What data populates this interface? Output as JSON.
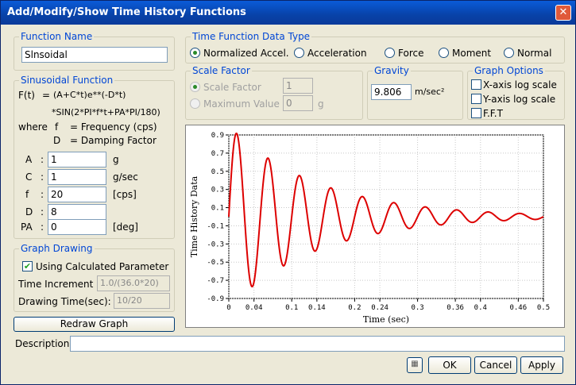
{
  "window": {
    "title": "Add/Modify/Show Time History Functions",
    "close_glyph": "✕"
  },
  "function_name": {
    "label": "Function Name",
    "value": "Slnsoidal"
  },
  "sinusoidal": {
    "title": "Sinusoidal Function",
    "formula_lhs": "F(t)",
    "eq": "=",
    "formula_line1": "(A+C*t)e**(-D*t)",
    "formula_line2": "*SIN(2*PI*f*t+PA*PI/180)",
    "where": "where",
    "f_name": "f",
    "f_def": "= Frequency (cps)",
    "d_name": "D",
    "d_def": "= Damping Factor",
    "params": [
      {
        "name": "A",
        "sep": ":",
        "value": "1",
        "unit": "g"
      },
      {
        "name": "C",
        "sep": ":",
        "value": "1",
        "unit": "g/sec"
      },
      {
        "name": "f",
        "sep": ":",
        "value": "20",
        "unit": "[cps]"
      },
      {
        "name": "D",
        "sep": ":",
        "value": "8",
        "unit": ""
      },
      {
        "name": "PA",
        "sep": ":",
        "value": "0",
        "unit": "[deg]"
      }
    ]
  },
  "graph_drawing": {
    "title": "Graph Drawing",
    "use_calc_label": "Using Calculated Parameter",
    "use_calc_checked": true,
    "time_inc_label": "Time Increment :",
    "time_inc_value": "1.0/(36.0*20)",
    "draw_time_label": "Drawing Time(sec):",
    "draw_time_value": "10/20"
  },
  "redraw_label": "Redraw Graph",
  "data_type": {
    "title": "Time Function Data Type",
    "options": [
      "Normalized Accel.",
      "Acceleration",
      "Force",
      "Moment",
      "Normal"
    ],
    "selected": "Normalized Accel."
  },
  "scale_factor": {
    "title": "Scale Factor",
    "sf_label": "Scale Factor",
    "sf_value": "1",
    "max_label": "Maximum Value",
    "max_value": "0",
    "max_unit": "g"
  },
  "gravity": {
    "title": "Gravity",
    "value": "9.806",
    "unit": "m/sec²"
  },
  "graph_options": {
    "title": "Graph Options",
    "x_log": "X-axis log scale",
    "y_log": "Y-axis log scale",
    "fft": "F.F.T"
  },
  "description": {
    "label": "Description",
    "value": ""
  },
  "buttons": {
    "ok": "OK",
    "cancel": "Cancel",
    "apply": "Apply"
  },
  "chart_data": {
    "type": "line",
    "title": "",
    "xlabel": "Time (sec)",
    "ylabel": "Time History Data",
    "xlim": [
      0,
      0.5
    ],
    "ylim": [
      -0.9,
      0.9
    ],
    "x_ticks": [
      0,
      0.04,
      0.1,
      0.14,
      0.2,
      0.24,
      0.3,
      0.36,
      0.4,
      0.46,
      0.5
    ],
    "y_ticks": [
      0.9,
      0.7,
      0.5,
      0.3,
      0.1,
      -0.1,
      -0.3,
      -0.5,
      -0.7,
      -0.9
    ],
    "color": "#dd0000",
    "grid": true,
    "function": {
      "A": 1,
      "C": 1,
      "f": 20,
      "D": 8,
      "PA": 0,
      "dt": "1.0/(36.0*20)",
      "t_end": 0.5
    },
    "peaks": [
      [
        0.0125,
        0.91
      ],
      [
        0.0375,
        -0.74
      ],
      [
        0.0625,
        0.61
      ],
      [
        0.0875,
        -0.51
      ],
      [
        0.1125,
        0.43
      ],
      [
        0.1375,
        -0.36
      ],
      [
        0.1625,
        0.3
      ],
      [
        0.1875,
        -0.25
      ],
      [
        0.2125,
        0.21
      ],
      [
        0.2375,
        -0.17
      ],
      [
        0.2625,
        0.14
      ],
      [
        0.2875,
        -0.12
      ],
      [
        0.3125,
        0.1
      ],
      [
        0.3375,
        -0.08
      ],
      [
        0.3625,
        0.07
      ],
      [
        0.3875,
        -0.05
      ],
      [
        0.4125,
        0.05
      ],
      [
        0.4375,
        -0.04
      ],
      [
        0.4625,
        0.03
      ],
      [
        0.4875,
        -0.02
      ]
    ]
  }
}
